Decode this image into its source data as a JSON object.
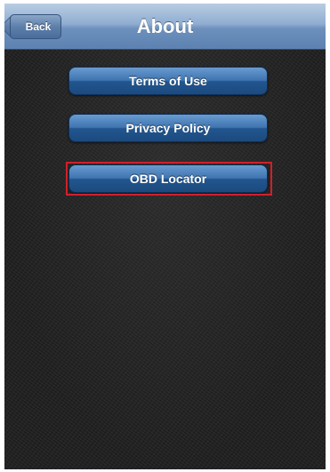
{
  "navbar": {
    "title": "About",
    "back_label": "Back"
  },
  "menu": {
    "items": [
      {
        "label": "Terms of Use"
      },
      {
        "label": "Privacy Policy"
      },
      {
        "label": "OBD Locator"
      }
    ]
  },
  "colors": {
    "navbar": "#7f9fc6",
    "button": "#2c5f99",
    "background": "#1e1e1e",
    "highlight": "#d0202a"
  }
}
